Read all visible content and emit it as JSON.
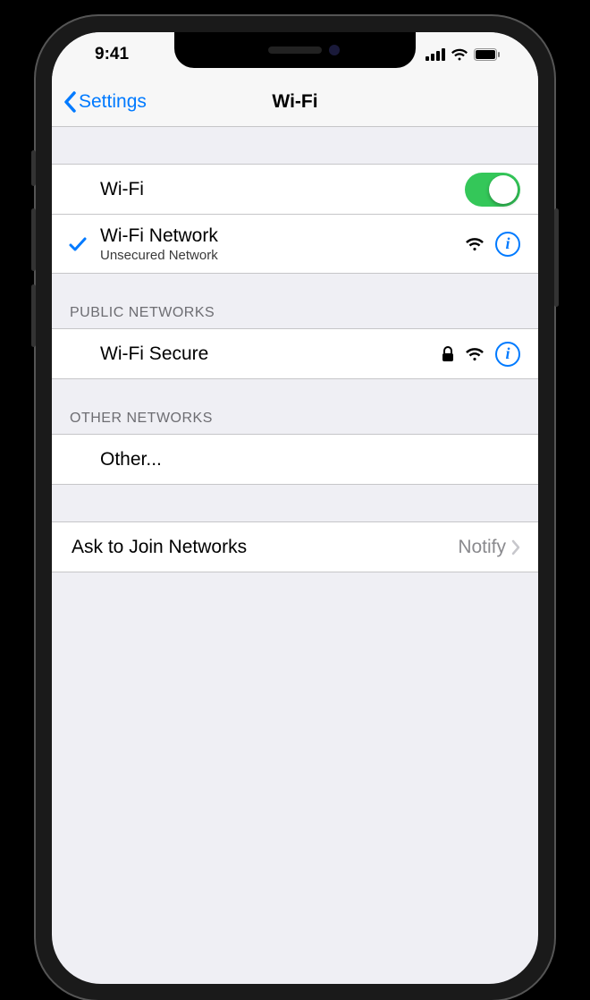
{
  "status": {
    "time": "9:41"
  },
  "nav": {
    "back_label": "Settings",
    "title": "Wi-Fi"
  },
  "wifi_toggle": {
    "label": "Wi-Fi",
    "on": true
  },
  "connected": {
    "name": "Wi-Fi Network",
    "subtitle": "Unsecured Network"
  },
  "sections": {
    "public_header": "PUBLIC NETWORKS",
    "other_header": "OTHER NETWORKS"
  },
  "public_networks": [
    {
      "name": "Wi-Fi Secure",
      "locked": true
    }
  ],
  "other_label": "Other...",
  "ask_to_join": {
    "label": "Ask to Join Networks",
    "value": "Notify"
  }
}
